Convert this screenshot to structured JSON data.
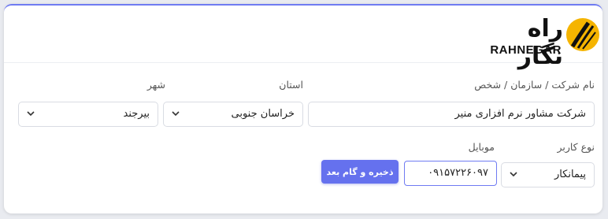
{
  "brand": {
    "name_fa": "راه نگار",
    "name_en": "RAHNEGAR"
  },
  "colors": {
    "accent": "#6571ee",
    "logo_yellow": "#f5b400"
  },
  "form": {
    "company": {
      "label": "نام شرکت / سازمان / شخص",
      "value": "شرکت مشاور نرم افزاری منیر"
    },
    "province": {
      "label": "استان",
      "value": "خراسان جنوبی",
      "icon": "chevron-down-icon"
    },
    "city": {
      "label": "شهر",
      "value": "بیرجند",
      "icon": "chevron-down-icon"
    },
    "user_type": {
      "label": "نوع کاربر",
      "value": "پیمانکار",
      "icon": "chevron-down-icon"
    },
    "mobile": {
      "label": "موبایل",
      "value": "۰۹۱۵۷۲۲۶۰۹۷"
    },
    "submit": {
      "label": "ذخیره و گام بعد"
    }
  }
}
